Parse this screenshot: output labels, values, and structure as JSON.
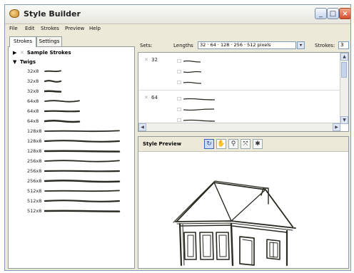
{
  "window": {
    "title": "Style Builder"
  },
  "menu": [
    "File",
    "Edit",
    "Strokes",
    "Preview",
    "Help"
  ],
  "tabs": {
    "strokes": "Strokes",
    "settings": "Settings"
  },
  "tree": {
    "sample_group": "Sample Strokes",
    "twigs_group": "Twigs",
    "strokes": [
      "32x8",
      "32x8",
      "32x8",
      "64x8",
      "64x8",
      "64x8",
      "128x8",
      "128x8",
      "128x8",
      "256x8",
      "256x8",
      "256x8",
      "512x8",
      "512x8",
      "512x8"
    ]
  },
  "sets": {
    "label": "Sets:",
    "lengths_label": "Lengths",
    "lengths_value": "32 · 64 · 128 · 256 · 512 pixels",
    "strokes_label": "Strokes:",
    "strokes_value": "3",
    "rows": [
      {
        "length": "32"
      },
      {
        "length": "64"
      }
    ]
  },
  "preview": {
    "title": "Style Preview",
    "tools": [
      "orbit-icon",
      "pan-icon",
      "zoom-icon",
      "zoom-extents-icon",
      "bug-icon"
    ]
  },
  "icons": {
    "minimize": "minimize-icon",
    "maximize": "maximize-icon",
    "close": "close-icon"
  },
  "colors": {
    "window_bg": "#ece9d8",
    "border": "#919b9c",
    "ink": "#2a2a22"
  }
}
